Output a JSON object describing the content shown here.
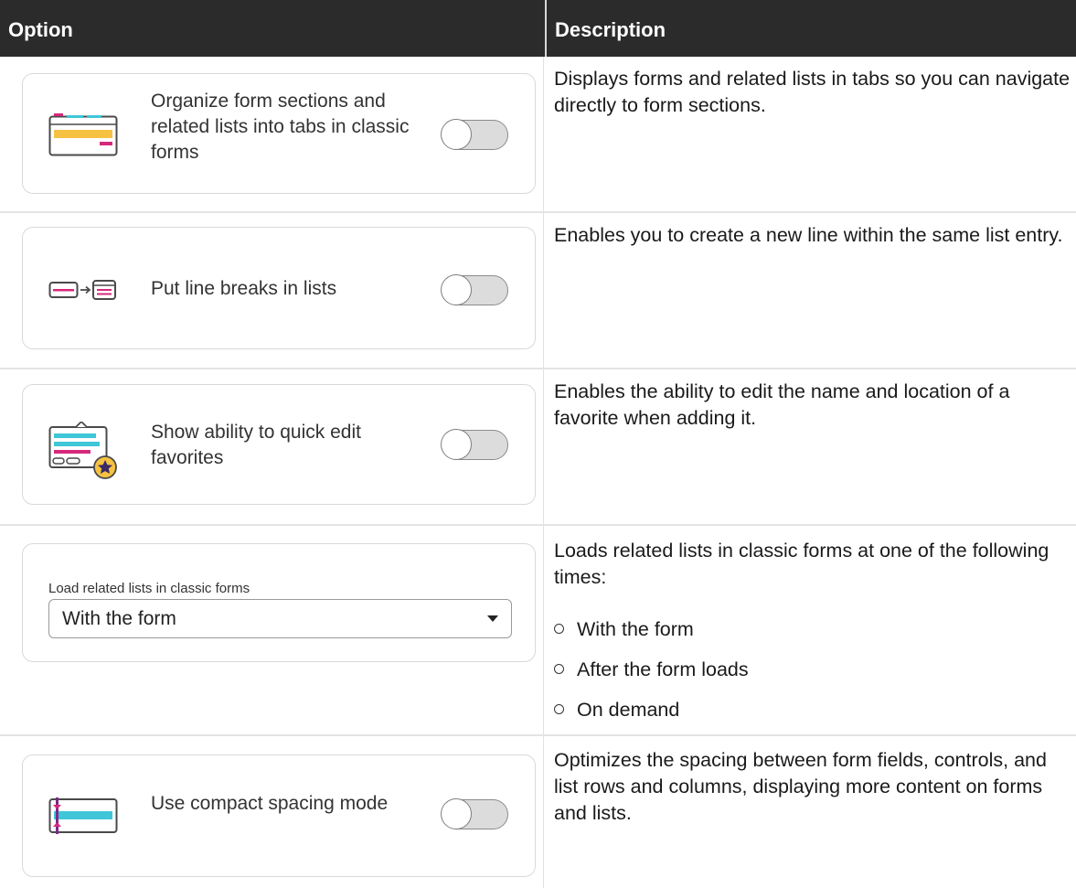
{
  "header": {
    "col1": "Option",
    "col2": "Description"
  },
  "rows": [
    {
      "icon": "tabs-form-icon",
      "label": "Organize form sections and related lists into tabs in classic forms",
      "toggle_on": false,
      "description": "Displays forms and related lists in tabs so you can navigate directly to form sections."
    },
    {
      "icon": "line-break-icon",
      "label": "Put line breaks in lists",
      "toggle_on": false,
      "description": "Enables you to create a new line within the same list entry."
    },
    {
      "icon": "favorite-edit-icon",
      "label": "Show ability to quick edit favorites",
      "toggle_on": false,
      "description": "Enables the ability to edit the name and location of a favorite when adding it."
    },
    {
      "select_label": "Load related lists in classic forms",
      "select_value": "With the form",
      "description": "Loads related lists in classic forms at one of the following times:",
      "bullets": [
        "With the form",
        "After the form loads",
        "On demand"
      ]
    },
    {
      "icon": "compact-spacing-icon",
      "label": "Use compact spacing mode",
      "toggle_on": false,
      "description": "Optimizes the spacing between form fields, controls, and list rows and columns, displaying more content on forms and lists."
    }
  ],
  "colors": {
    "header_bg": "#2b2b2b",
    "accent_yellow": "#f5c242",
    "accent_pink": "#d6287b",
    "accent_teal": "#3fc6d9",
    "accent_purple": "#7a2a86"
  }
}
